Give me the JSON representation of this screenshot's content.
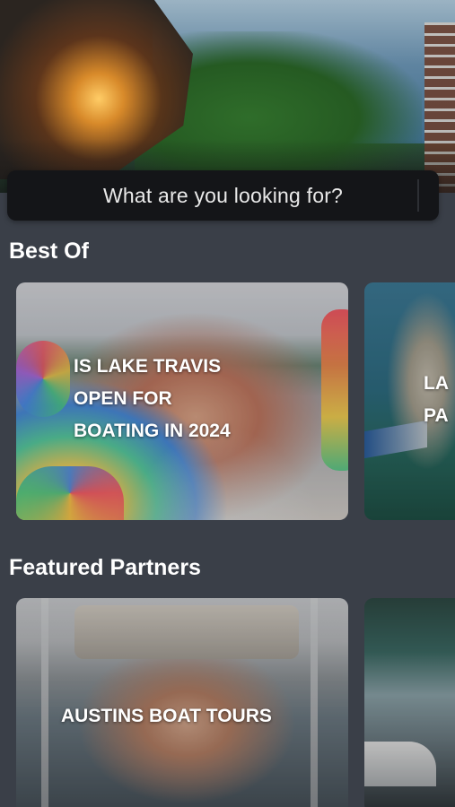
{
  "hero": {
    "image_label": "hero-image"
  },
  "search": {
    "placeholder": "What are you looking for?"
  },
  "sections": {
    "best_of": {
      "title": "Best Of",
      "cards": [
        {
          "title": "IS LAKE TRAVIS\nOPEN FOR\nBOATING IN 2024"
        },
        {
          "title": "LA\nPA"
        }
      ]
    },
    "featured_partners": {
      "title": "Featured Partners",
      "cards": [
        {
          "title": "AUSTINS BOAT TOURS"
        },
        {
          "title": ""
        }
      ]
    }
  },
  "colors": {
    "background": "#3a3f48",
    "search_bg": "#141518",
    "text": "#ffffff"
  }
}
